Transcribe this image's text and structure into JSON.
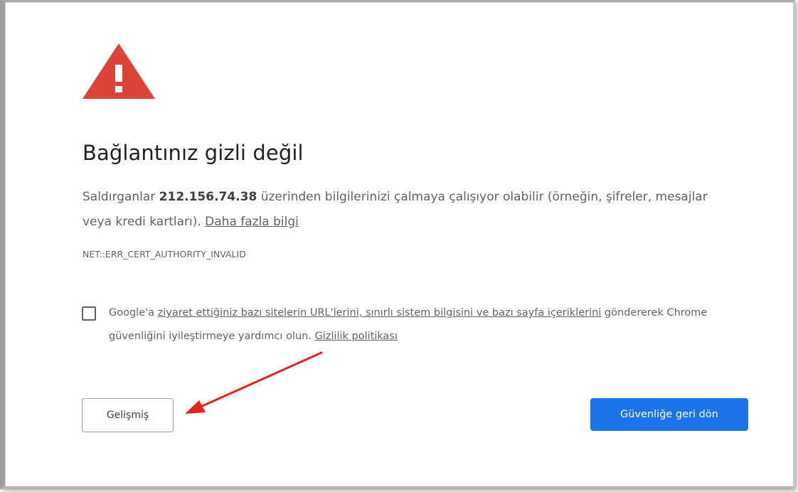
{
  "page": {
    "title": "Bağlantınız gizli değil",
    "explanation_prefix": "Saldırganlar ",
    "host": "212.156.74.38",
    "explanation_suffix": " üzerinden bilgilerinizi çalmaya çalışıyor olabilir (örneğin, şifreler, mesajlar veya kredi kartları). ",
    "learn_more_link": "Daha fazla bilgi",
    "error_code": "NET::ERR_CERT_AUTHORITY_INVALID"
  },
  "opt_in": {
    "checked": false,
    "prefix": "Google'a ",
    "data_link": "ziyaret ettiğiniz bazı sitelerin URL'lerini, sınırlı sistem bilgisini ve bazı sayfa içeriklerini",
    "middle": " göndererek Chrome güvenliğini iyileştirmeye yardımcı olun. ",
    "privacy_link": "Gizlilik politikası"
  },
  "buttons": {
    "advanced_label": "Gelişmiş",
    "back_to_safety_label": "Güvenliğe geri dön"
  },
  "icons": {
    "warning": "warning-triangle-icon",
    "annotation": "red-arrow"
  },
  "colors": {
    "warning_red": "#db4437",
    "primary_blue": "#1a73e8",
    "annotation_arrow": "#e8211b"
  }
}
